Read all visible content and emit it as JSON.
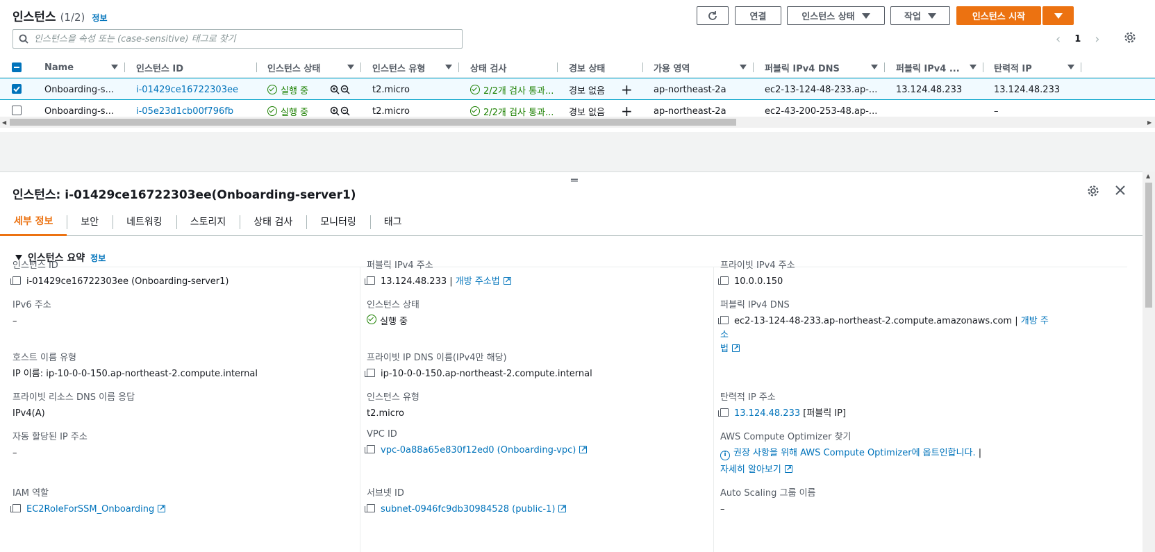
{
  "header": {
    "title": "인스턴스",
    "count": "(1/2)",
    "info": "정보",
    "refresh_icon": "refresh-icon",
    "connect_label": "연결",
    "instance_state_label": "인스턴스 상태",
    "actions_label": "작업",
    "launch_label": "인스턴스 시작",
    "search_placeholder": "인스턴스을 속성 또는 (case-sensitive) 태그로 찾기",
    "page": "1"
  },
  "table": {
    "columns": [
      "Name",
      "인스턴스 ID",
      "인스턴스 상태",
      "인스턴스 유형",
      "상태 검사",
      "경보 상태",
      "가용 영역",
      "퍼블릭 IPv4 DNS",
      "퍼블릭 IPv4 ...",
      "탄력적 IP"
    ],
    "rows": [
      {
        "selected": true,
        "name": "Onboarding-s...",
        "id": "i-01429ce16722303ee",
        "state": "실행 중",
        "type": "t2.micro",
        "check": "2/2개 검사 통과...",
        "alarm": "경보 없음",
        "az": "ap-northeast-2a",
        "dns": "ec2-13-124-48-233.ap-...",
        "ipv4": "13.124.48.233",
        "eip": "13.124.48.233"
      },
      {
        "selected": false,
        "name": "Onboarding-s...",
        "id": "i-05e23d1cb00f796fb",
        "state": "실행 중",
        "type": "t2.micro",
        "check": "2/2개 검사 통과...",
        "alarm": "경보 없음",
        "az": "ap-northeast-2a",
        "dns": "ec2-43-200-253-48.ap-...",
        "ipv4": "",
        "eip": "–"
      }
    ]
  },
  "detail": {
    "title": "인스턴스: i-01429ce16722303ee(Onboarding-server1)",
    "tabs": [
      "세부 정보",
      "보안",
      "네트워킹",
      "스토리지",
      "상태 검사",
      "모니터링",
      "태그"
    ],
    "section_title": "인스턴스 요약",
    "section_info": "정보",
    "col1": {
      "instance_id_label": "인스턴스 ID",
      "instance_id_value": "i-01429ce16722303ee (Onboarding-server1)",
      "ipv6_label": "IPv6 주소",
      "ipv6_value": "–",
      "hostname_type_label": "호스트 이름 유형",
      "hostname_type_value": "IP 이름: ip-10-0-0-150.ap-northeast-2.compute.internal",
      "private_dns_resp_label": "프라이빗 리소스 DNS 이름 응답",
      "private_dns_resp_value": "IPv4(A)",
      "auto_ip_label": "자동 할당된 IP 주소",
      "auto_ip_value": "–",
      "iam_label": "IAM 역할",
      "iam_value": "EC2RoleForSSM_Onboarding"
    },
    "col2": {
      "public_ipv4_label": "퍼블릭 IPv4 주소",
      "public_ipv4_value": "13.124.48.233",
      "public_ipv4_sep": " | ",
      "open_address": "개방 주소법",
      "state_label": "인스턴스 상태",
      "state_value": "실행 중",
      "private_ip_dns_label": "프라이빗 IP DNS 이름(IPv4만 해당)",
      "private_ip_dns_value": "ip-10-0-0-150.ap-northeast-2.compute.internal",
      "type_label": "인스턴스 유형",
      "type_value": "t2.micro",
      "vpc_label": "VPC ID",
      "vpc_value": "vpc-0a88a65e830f12ed0 (Onboarding-vpc)",
      "subnet_label": "서브넷 ID",
      "subnet_value": "subnet-0946fc9db30984528 (public-1)"
    },
    "col3": {
      "private_ipv4_label": "프라이빗 IPv4 주소",
      "private_ipv4_value": "10.0.0.150",
      "public_dns_label": "퍼블릭 IPv4 DNS",
      "public_dns_value": "ec2-13-124-48-233.ap-northeast-2.compute.amazonaws.com",
      "public_dns_sep": " | ",
      "open_address_1": "개방 주소",
      "open_address_2": "법",
      "eip_label": "탄력적 IP 주소",
      "eip_value": "13.124.48.233",
      "eip_suffix": " [퍼블릭 IP]",
      "optimizer_label": "AWS Compute Optimizer 찾기",
      "optimizer_text": "권장 사항을 위해 AWS Compute Optimizer에 옵트인합니다.",
      "optimizer_sep": " |",
      "learn_more": "자세히 알아보기",
      "asg_label": "Auto Scaling 그룹 이름",
      "asg_value": "–"
    }
  },
  "colors": {
    "accent": "#ec7211",
    "link": "#0073bb",
    "success": "#1d8102"
  }
}
